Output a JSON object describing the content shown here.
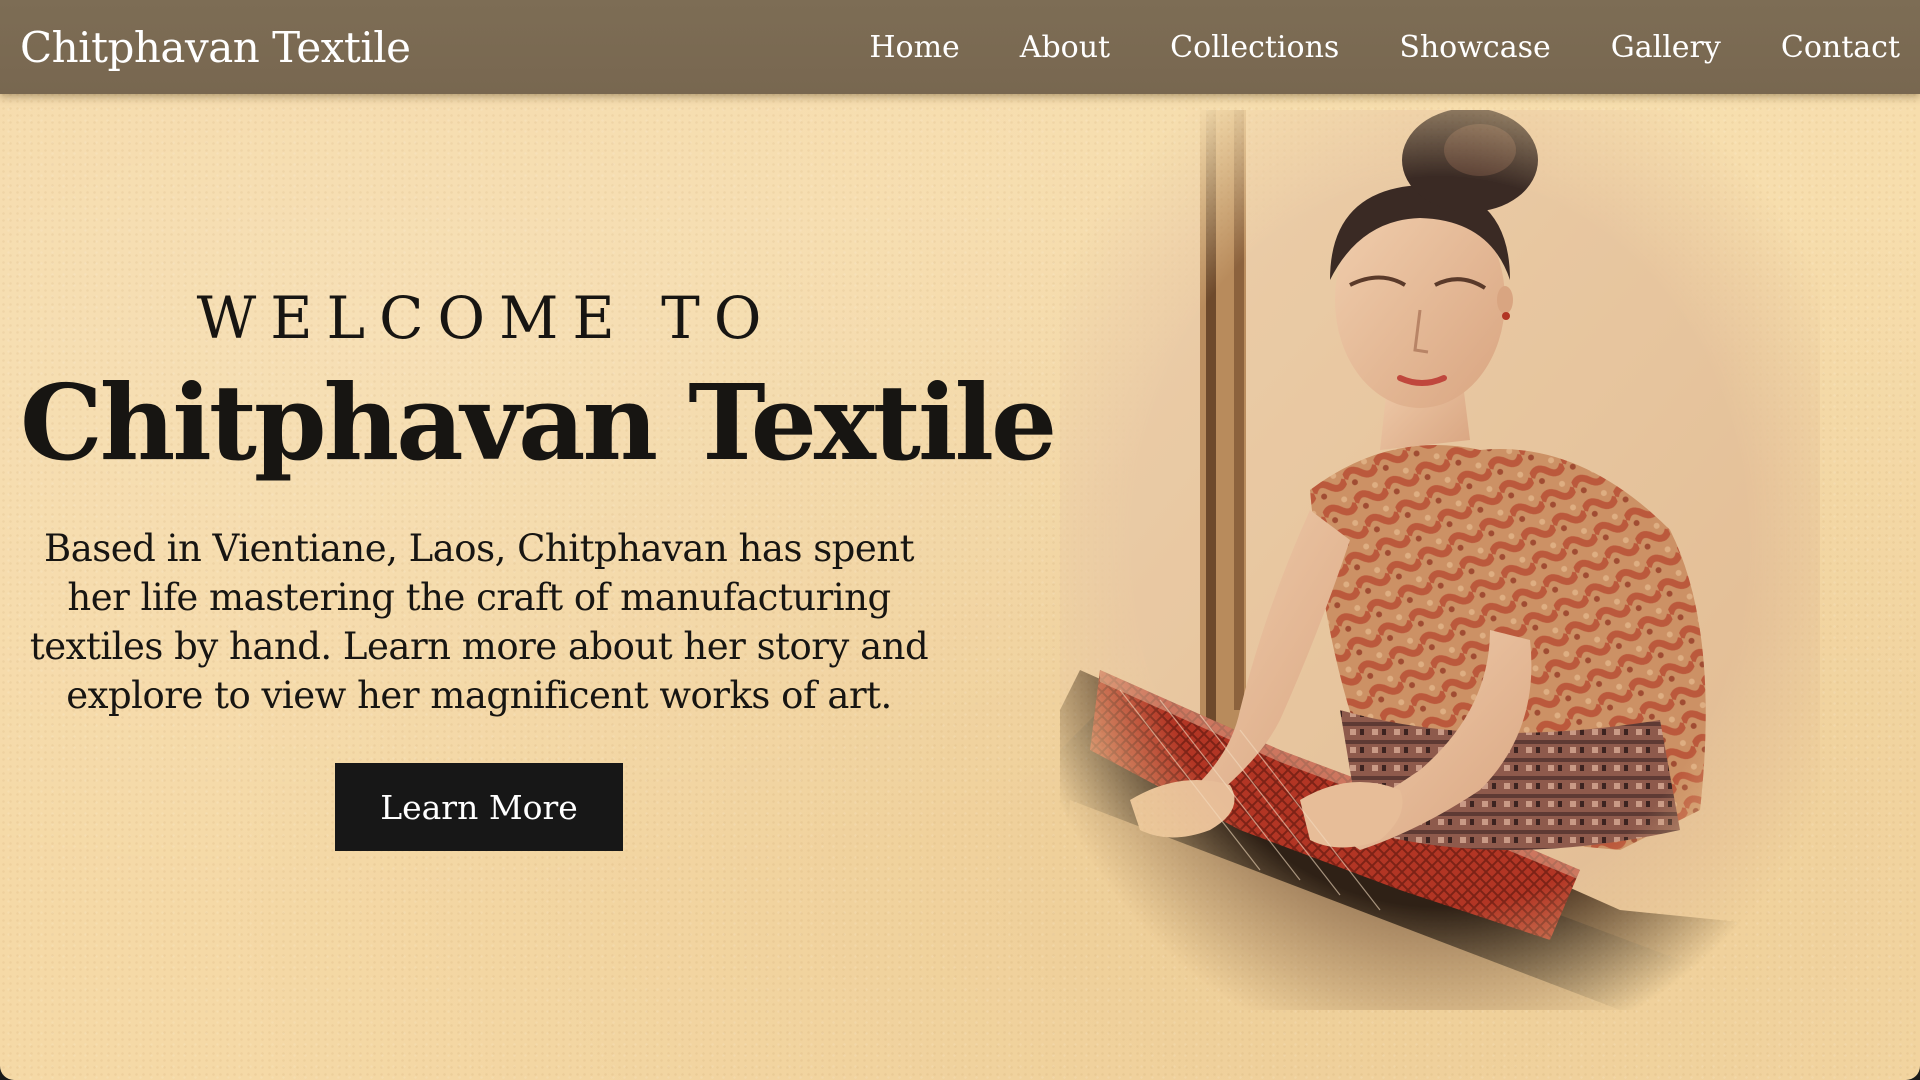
{
  "nav": {
    "brand": "Chitphavan Textile",
    "links": [
      "Home",
      "About",
      "Collections",
      "Showcase",
      "Gallery",
      "Contact"
    ]
  },
  "hero": {
    "welcome": "WELCOME TO",
    "title": "Chitphavan Textile",
    "description": "Based in Vientiane, Laos, Chitphavan has spent her life mastering the craft of manufacturing textiles by hand. Learn more about her story and explore to view her magnificent works of art.",
    "button_label": "Learn More"
  },
  "image": {
    "subject": "woman-weaving-at-loom-painting"
  },
  "colors": {
    "nav_bg": "#7a6a52",
    "page_bg": "#f5d9a6",
    "text": "#171512",
    "button_bg": "#171717",
    "button_text": "#ffffff"
  }
}
